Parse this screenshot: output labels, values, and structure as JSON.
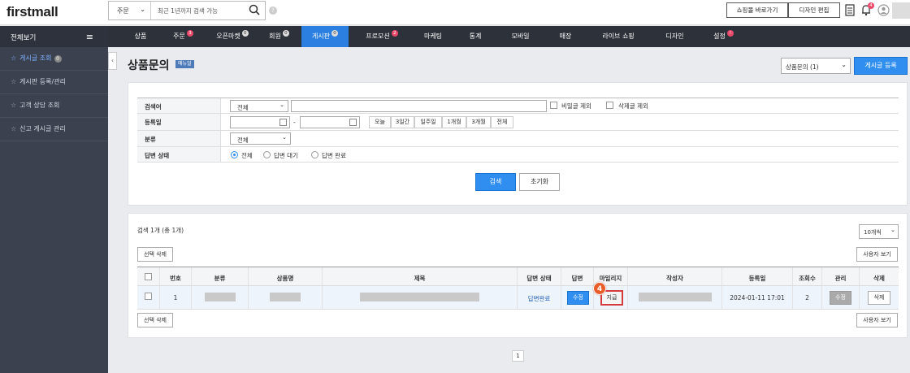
{
  "app": {
    "logo": "firstmall"
  },
  "topbar": {
    "search_type": "주문",
    "search_placeholder": "최근 1년까지 검색 가능",
    "shop_button": "쇼핑몰 바로가기",
    "design_button": "디자인 편집",
    "notice_badge": "4"
  },
  "leftnav": {
    "title": "전체보기",
    "items": [
      {
        "label": "게시글 조회",
        "badge": "0"
      },
      {
        "label": "게시판 등록/관리"
      },
      {
        "label": "고객 상담 조회"
      },
      {
        "label": "신고 게시글 관리"
      }
    ]
  },
  "gnb": [
    {
      "label": "상품"
    },
    {
      "label": "주문",
      "badge": "3"
    },
    {
      "label": "오픈마켓",
      "badge": "0"
    },
    {
      "label": "회원",
      "badge": "0"
    },
    {
      "label": "게시판",
      "badge": "0"
    },
    {
      "label": "프로모션",
      "badge": "2"
    },
    {
      "label": "마케팅"
    },
    {
      "label": "통계"
    },
    {
      "label": "모바일"
    },
    {
      "label": "매장"
    },
    {
      "label": "라이브 쇼핑"
    },
    {
      "label": "디자인"
    },
    {
      "label": "설정",
      "badge": "!"
    }
  ],
  "page": {
    "title": "상품문의",
    "manual": "매뉴얼",
    "board_select": "상품문의 (1)",
    "register_button": "게시글 등록"
  },
  "filters": {
    "keyword_label": "검색어",
    "keyword_field": "전체",
    "exclude_secret": "비밀글 제외",
    "exclude_deleted": "삭제글 제외",
    "date_label": "등록일",
    "date_sep": "-",
    "date_buttons": [
      "오늘",
      "3일간",
      "일주일",
      "1개월",
      "3개월",
      "전체"
    ],
    "category_label": "분류",
    "category_value": "전체",
    "answer_label": "답변 상태",
    "answer_options": [
      "전체",
      "답변 대기",
      "답변 완료"
    ],
    "search_button": "검색",
    "reset_button": "초기화"
  },
  "results": {
    "count_text": "검색 1개 (총 1개)",
    "per_page": "10개씩",
    "delete_selected": "선택 삭제",
    "user_view": "사용자 보기",
    "columns": [
      "번호",
      "분류",
      "상품명",
      "제목",
      "답변 상태",
      "답변",
      "마일리지",
      "작성자",
      "등록일",
      "조회수",
      "관리",
      "삭제"
    ],
    "rows": [
      {
        "no": "1",
        "status": "답변완료",
        "answer_btn": "수정",
        "mileage_btn": "지급",
        "date": "2024-01-11 17:01",
        "views": "2",
        "manage_btn": "수정",
        "delete_btn": "삭제"
      }
    ]
  },
  "pagination": {
    "current": "1"
  },
  "callout": {
    "step": "4"
  }
}
